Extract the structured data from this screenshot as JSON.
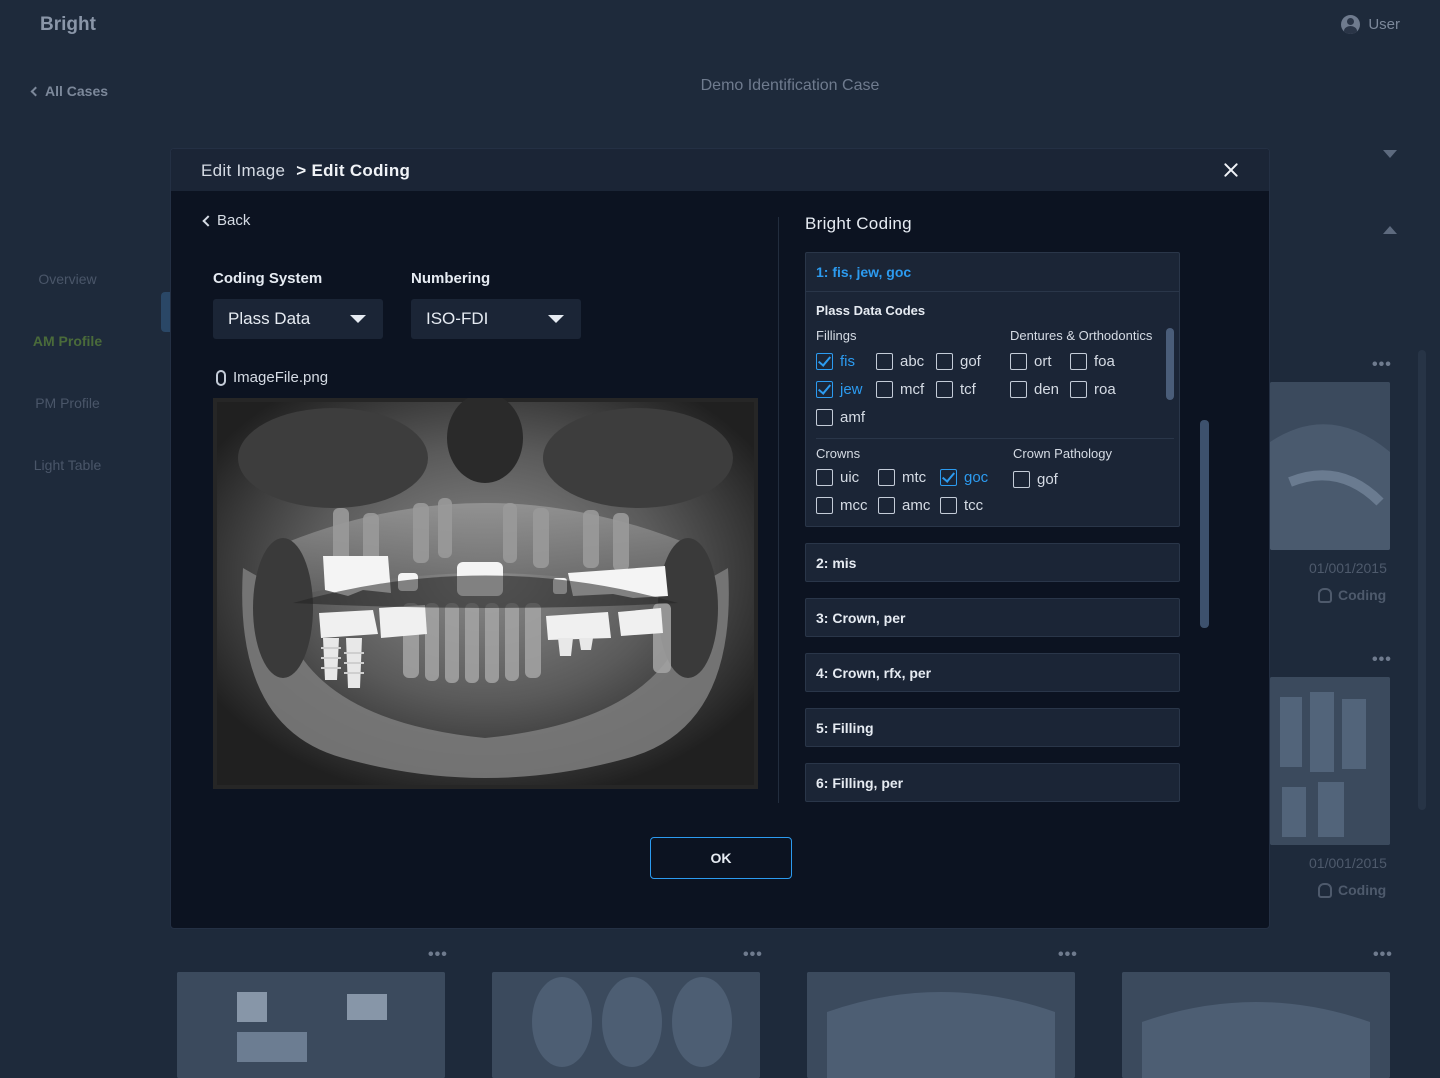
{
  "app": {
    "logo": "Bright",
    "user_label": "User"
  },
  "nav": {
    "back_label": "All Cases"
  },
  "case_title": "Demo Identification Case",
  "sidebar": {
    "items": [
      {
        "label": "Overview"
      },
      {
        "label": "AM Profile"
      },
      {
        "label": "PM Profile"
      },
      {
        "label": "Light Table"
      }
    ]
  },
  "background_cards": [
    {
      "date": "01/001/2015",
      "coding_label": "Coding"
    },
    {
      "date": "01/001/2015",
      "coding_label": "Coding"
    }
  ],
  "modal": {
    "breadcrumb": {
      "parent": "Edit Image",
      "current": "> Edit Coding"
    },
    "back_label": "Back",
    "coding_system": {
      "label": "Coding System",
      "value": "Plass Data"
    },
    "numbering": {
      "label": "Numbering",
      "value": "ISO-FDI"
    },
    "file_name": "ImageFile.png",
    "ok_label": "OK",
    "bright_coding": {
      "title": "Bright Coding",
      "open_item": {
        "header": "1: fis, jew, goc",
        "codes_title": "Plass Data Codes",
        "groups": {
          "fillings": {
            "title": "Fillings",
            "codes": [
              {
                "code": "fis",
                "checked": true
              },
              {
                "code": "abc",
                "checked": false
              },
              {
                "code": "gof",
                "checked": false
              },
              {
                "code": "jew",
                "checked": true
              },
              {
                "code": "mcf",
                "checked": false
              },
              {
                "code": "tcf",
                "checked": false
              },
              {
                "code": "amf",
                "checked": false
              }
            ]
          },
          "dentures": {
            "title": "Dentures & Orthodontics",
            "codes": [
              {
                "code": "ort",
                "checked": false
              },
              {
                "code": "foa",
                "checked": false
              },
              {
                "code": "den",
                "checked": false
              },
              {
                "code": "roa",
                "checked": false
              }
            ]
          },
          "crowns": {
            "title": "Crowns",
            "codes": [
              {
                "code": "uic",
                "checked": false
              },
              {
                "code": "mtc",
                "checked": false
              },
              {
                "code": "goc",
                "checked": true
              },
              {
                "code": "mcc",
                "checked": false
              },
              {
                "code": "amc",
                "checked": false
              },
              {
                "code": "tcc",
                "checked": false
              }
            ]
          },
          "crown_pathology": {
            "title": "Crown Pathology",
            "codes": [
              {
                "code": "gof",
                "checked": false
              }
            ]
          }
        }
      },
      "collapsed_items": [
        {
          "label": "2: mis"
        },
        {
          "label": "3: Crown, per"
        },
        {
          "label": "4: Crown, rfx, per"
        },
        {
          "label": "5: Filling"
        },
        {
          "label": "6: Filling, per"
        }
      ]
    }
  },
  "colors": {
    "accent": "#2c9bf0",
    "modal_bg": "#0c1321",
    "panel_bg": "#1b2536",
    "page_bg": "#1e2a3b"
  }
}
